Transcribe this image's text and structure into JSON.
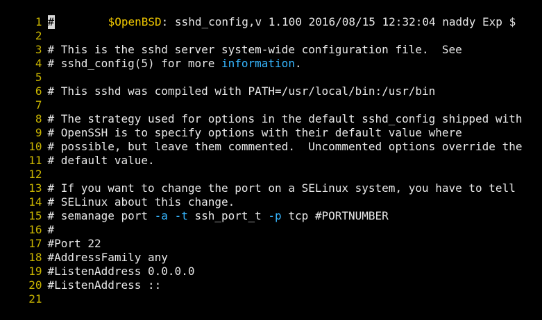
{
  "editor": {
    "lines": [
      {
        "n": "1",
        "a": "#",
        "b": "        ",
        "c": "$OpenBSD",
        "d": ": sshd_config,v 1.100 2016/08/15 12:32:04 naddy Exp $"
      },
      {
        "n": "2",
        "text": ""
      },
      {
        "n": "3",
        "text": "# This is the sshd server system-wide configuration file.  See"
      },
      {
        "n": "4",
        "a": "# sshd_config(5) for more ",
        "b": "information",
        "c": "."
      },
      {
        "n": "5",
        "text": ""
      },
      {
        "n": "6",
        "text": "# This sshd was compiled with PATH=/usr/local/bin:/usr/bin"
      },
      {
        "n": "7",
        "text": ""
      },
      {
        "n": "8",
        "text": "# The strategy used for options in the default sshd_config shipped with"
      },
      {
        "n": "9",
        "text": "# OpenSSH is to specify options with their default value where"
      },
      {
        "n": "10",
        "text": "# possible, but leave them commented.  Uncommented options override the"
      },
      {
        "n": "11",
        "text": "# default value."
      },
      {
        "n": "12",
        "text": ""
      },
      {
        "n": "13",
        "text": "# If you want to change the port on a SELinux system, you have to tell"
      },
      {
        "n": "14",
        "text": "# SELinux about this change."
      },
      {
        "n": "15",
        "a": "# semanage port ",
        "b": "-a",
        "c": " ",
        "d": "-t",
        "e": " ssh_port_t ",
        "f": "-p",
        "g": " tcp #PORTNUMBER"
      },
      {
        "n": "16",
        "text": "#"
      },
      {
        "n": "17",
        "text": "#Port 22"
      },
      {
        "n": "18",
        "text": "#AddressFamily any"
      },
      {
        "n": "19",
        "text": "#ListenAddress 0.0.0.0"
      },
      {
        "n": "20",
        "text": "#ListenAddress ::"
      },
      {
        "n": "21",
        "text": ""
      }
    ]
  },
  "colors": {
    "background": "#000000",
    "line_number": "#c8b400",
    "text": "#e8e8e8",
    "variable": "#f0c800",
    "option": "#36b6ff"
  }
}
